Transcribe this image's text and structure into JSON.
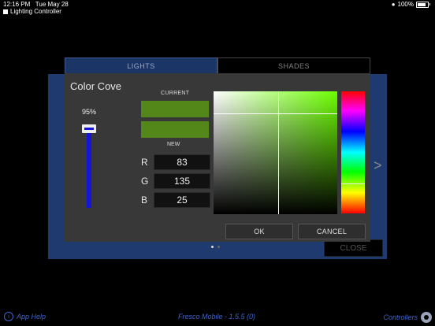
{
  "status_bar": {
    "time": "12:16 PM",
    "date": "Tue May 28",
    "battery": "100%",
    "app_name": "Lighting Controller"
  },
  "tabs": [
    {
      "label": "LIGHTS"
    },
    {
      "label": "SHADES"
    }
  ],
  "background": {
    "close_label": "CLOSE",
    "next_chevron": ">"
  },
  "dialog": {
    "title": "Color Cove",
    "brightness": "95%",
    "brightness_level": 0.95,
    "current_label": "CURRENT",
    "new_label": "NEW",
    "current_color": "#53871A",
    "new_color": "#53871A",
    "rgb": [
      {
        "label": "R",
        "value": "83"
      },
      {
        "label": "G",
        "value": "135"
      },
      {
        "label": "B",
        "value": "25"
      }
    ],
    "ok_label": "OK",
    "cancel_label": "CANCEL"
  },
  "footer": {
    "help_label": "App Help",
    "version": "Fresco Mobile - 1.5.5 (0)",
    "controllers_label": "Controllers"
  },
  "colors": {
    "accent": "#3f63c9",
    "slider": "#1515d8",
    "panel": "#1f3a6e"
  }
}
